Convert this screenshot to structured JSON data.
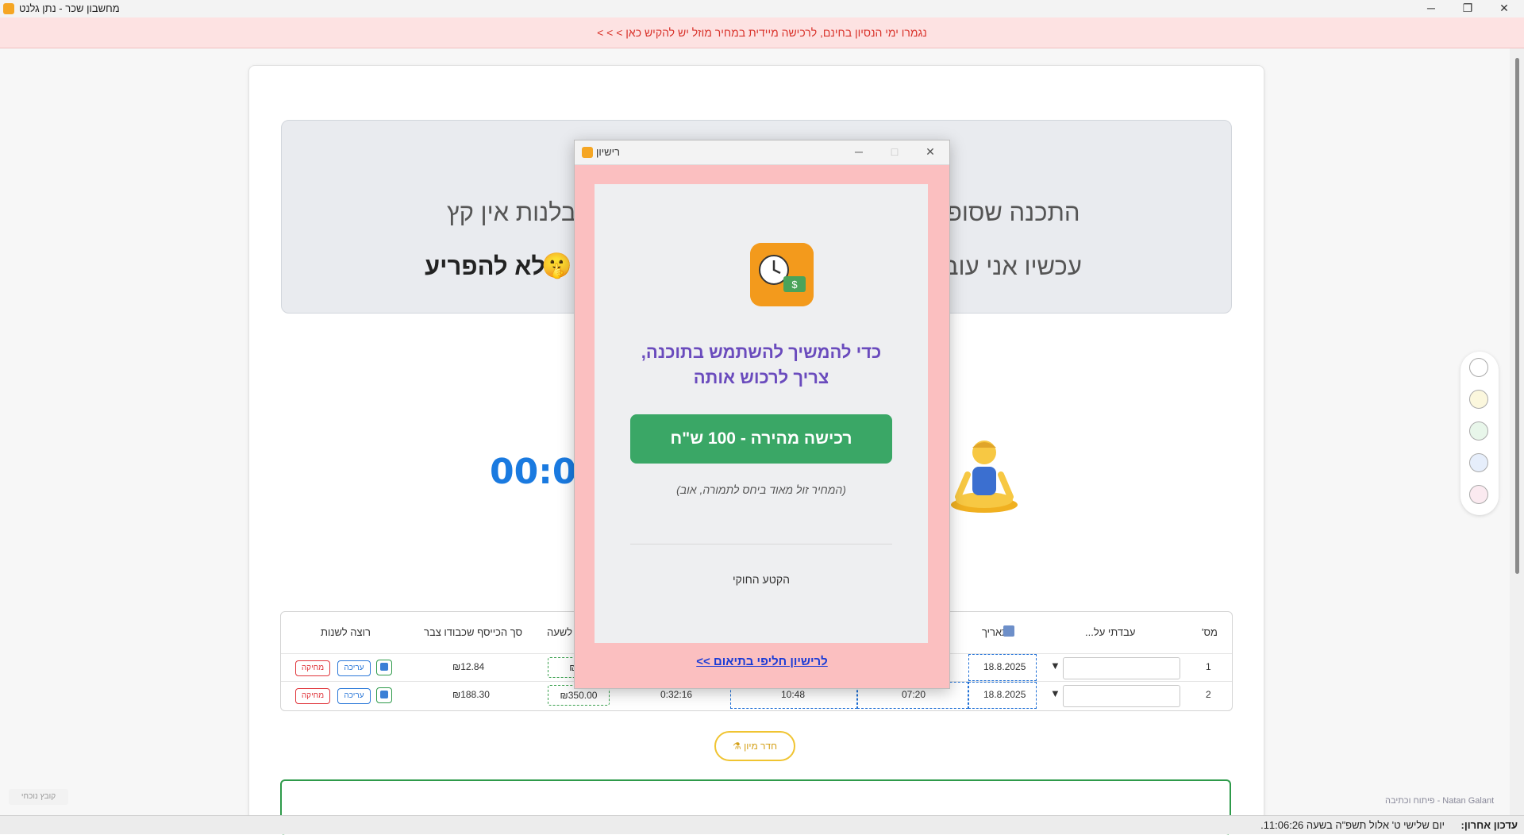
{
  "window": {
    "title": "מחשבון שכר - נתן גלנט",
    "minimize": "─",
    "maximize": "❐",
    "close": "✕"
  },
  "banner": {
    "text": "נגמרו ימי הנסיון בחינם, לרכישה מיידית במחיר מוזל יש להקיש כאן > > >"
  },
  "quote": {
    "line1_right": "התכנה שסופ",
    "line1_left": "סבלנות אין קץ",
    "line2_right": "עכשיו אני עוב",
    "line2_left": "לא להפריע",
    "line2_emoji": "🤫"
  },
  "timer": {
    "value": "00:00"
  },
  "table": {
    "headers": {
      "num": "מס'",
      "worked_on": "עבדתי על...",
      "date": "תאריך",
      "hourly": "לשעה",
      "total": "סך הכייסף שכבודו צבר",
      "want_change": "רוצה לשנות"
    },
    "rows": [
      {
        "num": "1",
        "date": "18.8.2025",
        "start": "",
        "end": "",
        "duration": "",
        "rate": "₪35",
        "total": "₪12.84",
        "edit": "עריכה",
        "delete": "מחיקה"
      },
      {
        "num": "2",
        "date": "18.8.2025",
        "start": "07:20",
        "end": "10:48",
        "duration": "0:32:16",
        "rate": "₪350.00",
        "total": "₪188.30",
        "edit": "עריכה",
        "delete": "מחיקה"
      }
    ]
  },
  "room_button": {
    "label": "חדר מיון ⚗"
  },
  "current_file": {
    "label": "קובץ נוכחי"
  },
  "credit": {
    "text": "פיתוח וכתיבה - Natan Galant"
  },
  "status": {
    "label": "עדכון אחרון:",
    "text": "יום שלישי ט' אלול תשפ\"ה בשעה 11:06:26."
  },
  "dialog": {
    "title": "רישיון",
    "heading_line1": "כדי להמשיך להשתמש בתוכנה,",
    "heading_line2": "צריך לרכוש אותה",
    "buy_button": "רכישה מהירה - 100 ש\"ח",
    "note": "(המחיר זול מאוד ביחס לתמורה, אוב)",
    "legal": "הקטע החוקי",
    "alt_link": "לרישיון חליפי בתיאום >>"
  },
  "colors": {
    "accent": "#1a7ae0",
    "banner_text": "#d9332b",
    "dialog_bg": "#fbbfc0",
    "buy_green": "#3aa766",
    "heading_purple": "#6a4bbd"
  },
  "swatches": [
    "#ffffff",
    "#fbf7dd",
    "#e8f6ea",
    "#e6eefb",
    "#fbeaf0"
  ]
}
